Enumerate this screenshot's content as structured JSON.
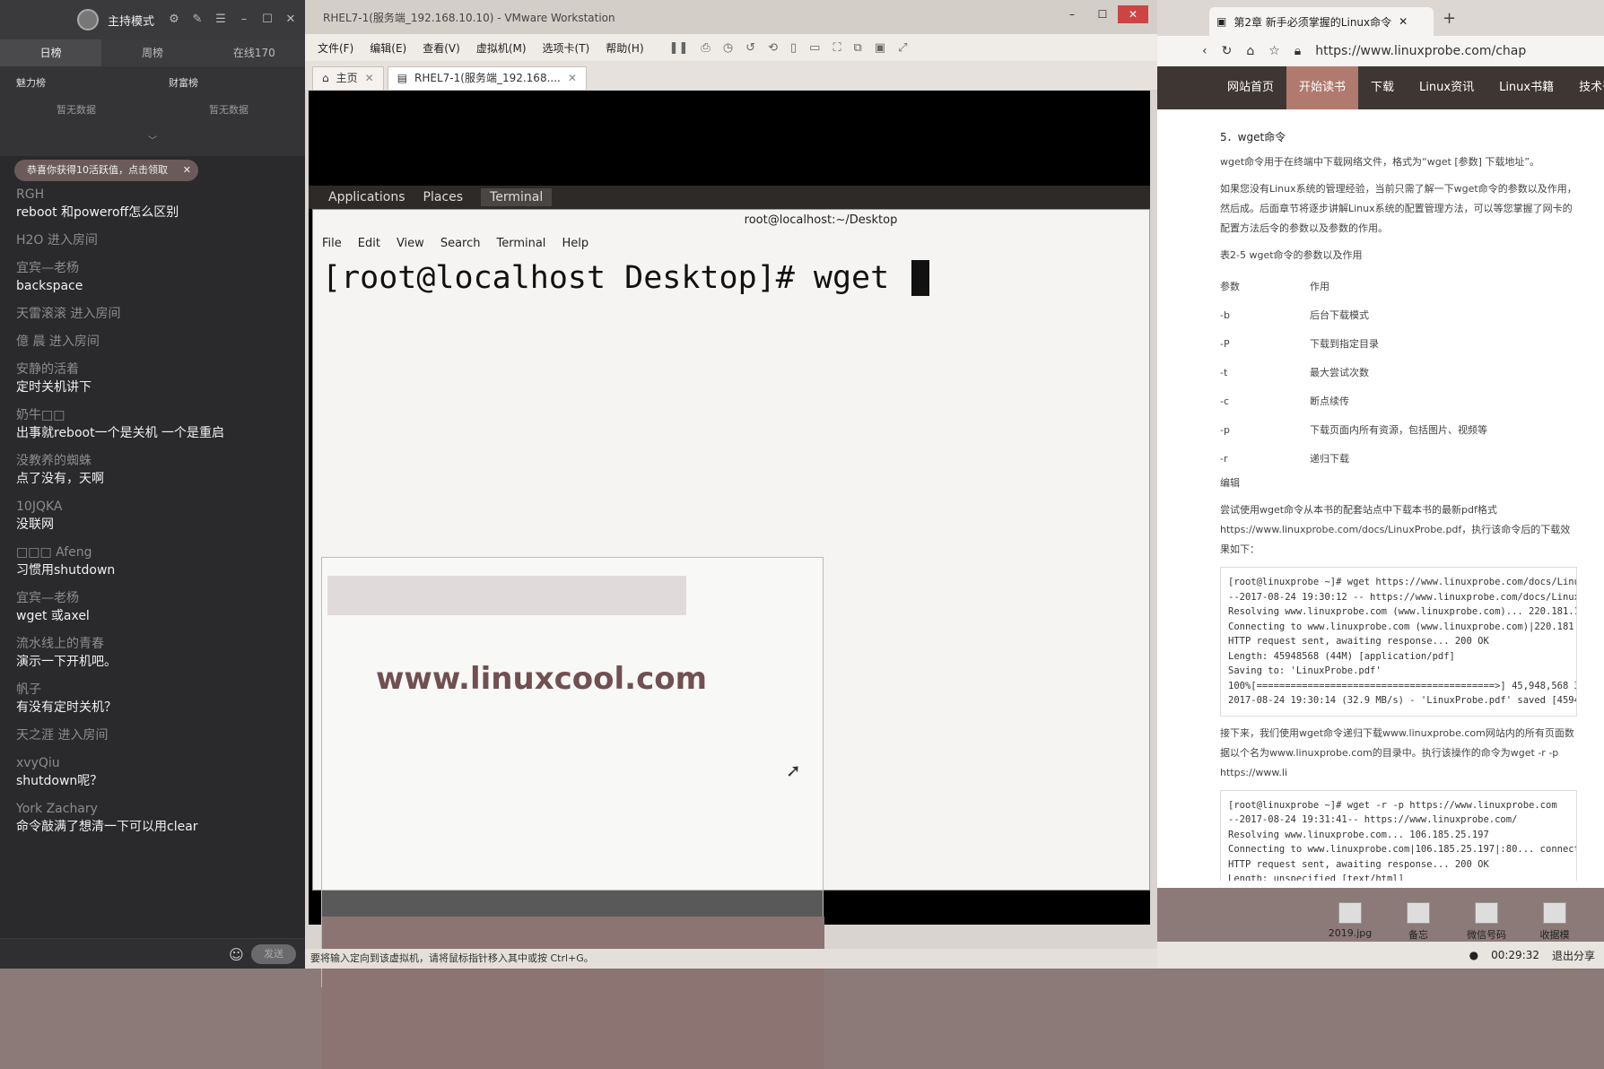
{
  "chat": {
    "mode_label": "主持模式",
    "rank_tabs": [
      "日榜",
      "周榜",
      "在线170"
    ],
    "boards": [
      {
        "title": "魅力榜",
        "empty": "暂无数据"
      },
      {
        "title": "财富榜",
        "empty": "暂无数据"
      }
    ],
    "notice": "恭喜你获得10活跃值，点击领取",
    "messages": [
      {
        "user": "RGH",
        "text": "reboot 和poweroff怎么区别"
      },
      {
        "user": "H2O 进入房间",
        "text": ""
      },
      {
        "user": "宜宾—老杨",
        "text": "backspace"
      },
      {
        "user": "天雷滚滚 进入房间",
        "text": ""
      },
      {
        "user": "億 晨  进入房间",
        "text": ""
      },
      {
        "user": "安静的活着",
        "text": "定时关机讲下"
      },
      {
        "user": "奶牛□□",
        "text": "出事就reboot一个是关机 一个是重启"
      },
      {
        "user": "没教养的蜘蛛",
        "text": "点了没有，天啊"
      },
      {
        "user": "10JQKA",
        "text": "没联网"
      },
      {
        "user": "□□□ Afeng",
        "text": "习惯用shutdown"
      },
      {
        "user": "宜宾—老杨",
        "text": "wget 或axel"
      },
      {
        "user": "流水线上的青春",
        "text": "演示一下开机吧。"
      },
      {
        "user": "帆子",
        "text": "有没有定时关机？"
      },
      {
        "user": "天之涯 进入房间",
        "text": ""
      },
      {
        "user": "xvyQiu",
        "text": "shutdown呢？"
      },
      {
        "user": "York Zachary",
        "text": "命令敲满了想清一下可以用clear"
      }
    ],
    "send_label": "发送"
  },
  "vmware": {
    "title": "RHEL7-1(服务端_192.168.10.10) - VMware Workstation",
    "menu": [
      "文件(F)",
      "编辑(E)",
      "查看(V)",
      "虚拟机(M)",
      "选项卡(T)",
      "帮助(H)"
    ],
    "tabs": [
      {
        "label": "主页"
      },
      {
        "label": "RHEL7-1(服务端_192.168...."
      }
    ],
    "gnome": {
      "applications": "Applications",
      "places": "Places",
      "terminal": "Terminal"
    },
    "terminal": {
      "title": "root@localhost:~/Desktop",
      "menu": [
        "File",
        "Edit",
        "View",
        "Search",
        "Terminal",
        "Help"
      ],
      "prompt": "[root@localhost Desktop]# wget "
    },
    "watermark": "www.linuxcool.com",
    "status": "要将输入定向到该虚拟机，请将鼠标指针移入其中或按 Ctrl+G。"
  },
  "browser": {
    "tab_title": "第2章 新手必须掌握的Linux命令",
    "url": "https://www.linuxprobe.com/chap",
    "nav": [
      "网站首页",
      "开始读书",
      "下载",
      "Linux资讯",
      "Linux书籍",
      "技术干"
    ],
    "section_title": "5．wget命令",
    "para1": "wget命令用于在终端中下载网络文件，格式为“wget [参数] 下载地址”。",
    "para2": "如果您没有Linux系统的管理经验，当前只需了解一下wget命令的参数以及作用，然后成。后面章节将逐步讲解Linux系统的配置管理方法，可以等您掌握了网卡的配置方法后令的参数以及参数的作用。",
    "table_caption": "表2-5          wget命令的参数以及作用",
    "table_header": [
      "参数",
      "作用"
    ],
    "table_rows": [
      [
        "-b",
        "后台下载模式"
      ],
      [
        "-P",
        "下载到指定目录"
      ],
      [
        "-t",
        "最大尝试次数"
      ],
      [
        "-c",
        "断点续传"
      ],
      [
        "-p",
        "下载页面内所有资源，包括图片、视频等"
      ],
      [
        "-r",
        "递归下载"
      ]
    ],
    "edit_label": "编辑",
    "para3": "尝试使用wget命令从本书的配套站点中下载本书的最新pdf格式 https://www.linuxprobe.com/docs/LinuxProbe.pdf，执行该命令后的下载效果如下：",
    "code1": "[root@linuxprobe ~]# wget https://www.linuxprobe.com/docs/Linux\n--2017-08-24 19:30:12 -- https://www.linuxprobe.com/docs/LinuxP\nResolving www.linuxprobe.com (www.linuxprobe.com)... 220.181.10\nConnecting to www.linuxprobe.com (www.linuxprobe.com)|220.181.10\nHTTP request sent, awaiting response... 200 OK\nLength: 45948568 (44M) [application/pdf]\nSaving to: 'LinuxProbe.pdf'\n100%[==========================================>] 45,948,568 3\n2017-08-24 19:30:14 (32.9 MB/s) - 'LinuxProbe.pdf' saved [45948",
    "para4": "接下来，我们使用wget命令递归下载www.linuxprobe.com网站内的所有页面数据以个名为www.linuxprobe.com的目录中。执行该操作的命令为wget -r -p https://www.li",
    "code2": "[root@linuxprobe ~]# wget -r -p https://www.linuxprobe.com\n--2017-08-24 19:31:41-- https://www.linuxprobe.com/\nResolving www.linuxprobe.com... 106.185.25.197\nConnecting to www.linuxprobe.com|106.185.25.197|:80... connecte\nHTTP request sent, awaiting response... 200 OK\nLength: unspecified [text/html]\nSaving to: 'www.linuxprobe.com/index.html'"
  },
  "desktop": {
    "files": [
      "2019.jpg",
      "备忘录.txt",
      "微信号码",
      "收据模板.xls"
    ],
    "timer": "00:29:32",
    "exit_share": "退出分享"
  }
}
